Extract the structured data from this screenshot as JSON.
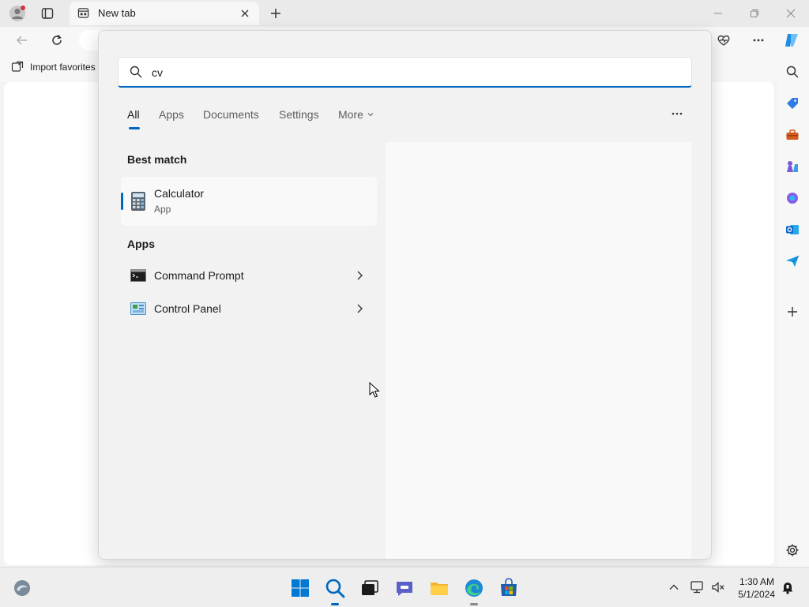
{
  "browser": {
    "tab_title": "New tab",
    "favorites_label": "Import favorites"
  },
  "search": {
    "query": "cv",
    "filters": [
      "All",
      "Apps",
      "Documents",
      "Settings",
      "More"
    ],
    "active_filter": "All"
  },
  "best_match": {
    "heading": "Best match",
    "title": "Calculator",
    "subtitle": "App"
  },
  "apps": {
    "heading": "Apps",
    "items": [
      {
        "label": "Command Prompt",
        "icon": "command-prompt-icon"
      },
      {
        "label": "Control Panel",
        "icon": "control-panel-icon"
      }
    ]
  },
  "taskbar": {
    "time": "1:30 AM",
    "date": "5/1/2024"
  },
  "colors": {
    "accent": "#0067c0",
    "panel_bg": "#f2f2f2",
    "card_bg": "#f9f9f9"
  }
}
